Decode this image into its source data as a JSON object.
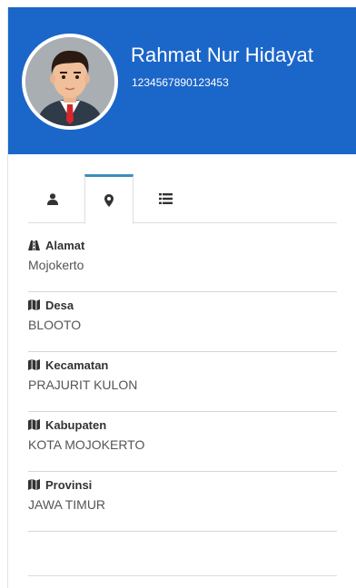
{
  "profile": {
    "name": "Rahmat Nur Hidayat",
    "id_number": "1234567890123453",
    "avatar_icon": "businessman-avatar-icon"
  },
  "colors": {
    "header_bg": "#1b66c9",
    "tab_active_accent": "#3c8dbc"
  },
  "tabs": [
    {
      "icon": "user-icon",
      "active": false
    },
    {
      "icon": "map-marker-icon",
      "active": true
    },
    {
      "icon": "list-icon",
      "active": false
    }
  ],
  "address": {
    "alamat": {
      "label": "Alamat",
      "value": "Mojokerto",
      "icon": "road-icon"
    },
    "desa": {
      "label": "Desa",
      "value": "BLOOTO",
      "icon": "map-icon"
    },
    "kecamatan": {
      "label": "Kecamatan",
      "value": "PRAJURIT KULON",
      "icon": "map-icon"
    },
    "kabupaten": {
      "label": "Kabupaten",
      "value": "KOTA MOJOKERTO",
      "icon": "map-icon"
    },
    "provinsi": {
      "label": "Provinsi",
      "value": "JAWA TIMUR",
      "icon": "map-icon"
    }
  }
}
